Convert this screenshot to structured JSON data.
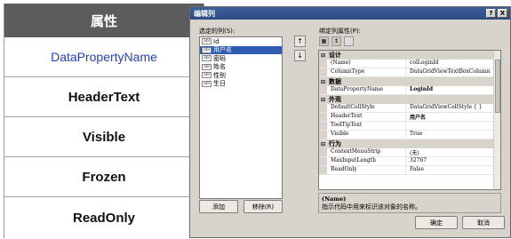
{
  "attr_table": {
    "header": "属性",
    "rows": [
      "DataPropertyName",
      "HeaderText",
      "Visible",
      "Frozen",
      "ReadOnly"
    ]
  },
  "dialog": {
    "title": "编辑列",
    "help_btn": "?",
    "close_btn": "X",
    "selected_columns_label": "选定的列(S):",
    "columns": [
      {
        "icon": "abl",
        "name": "Id"
      },
      {
        "icon": "abl",
        "name": "用户名"
      },
      {
        "icon": "abl",
        "name": "密码"
      },
      {
        "icon": "abl",
        "name": "姓名"
      },
      {
        "icon": "abl",
        "name": "性别"
      },
      {
        "icon": "abl",
        "name": "生日"
      }
    ],
    "selected_index": 1,
    "move_up": "↑",
    "move_down": "↓",
    "add_button": "添加",
    "remove_button": "移除(R)",
    "bound_props_label": "绑定列属性(P):",
    "property_grid": [
      {
        "type": "category",
        "toggle": "⊟",
        "name": "设计"
      },
      {
        "type": "prop",
        "name": "(Name)",
        "value": "colLoginId"
      },
      {
        "type": "prop",
        "name": "ColumnType",
        "value": "DataGridViewTextBoxColumn"
      },
      {
        "type": "category",
        "toggle": "⊟",
        "name": "数据"
      },
      {
        "type": "prop",
        "name": "DataPropertyName",
        "value": "LoginId",
        "bold": true
      },
      {
        "type": "category",
        "toggle": "⊟",
        "name": "外观"
      },
      {
        "type": "prop",
        "name": "DefaultCellStyle",
        "value": "DataGridViewCellStyle { }"
      },
      {
        "type": "prop",
        "name": "HeaderText",
        "value": "用户名",
        "bold": true
      },
      {
        "type": "prop",
        "name": "ToolTipText",
        "value": ""
      },
      {
        "type": "prop",
        "name": "Visible",
        "value": "True"
      },
      {
        "type": "category",
        "toggle": "⊟",
        "name": "行为"
      },
      {
        "type": "prop",
        "name": "ContextMenuStrip",
        "value": "(无)"
      },
      {
        "type": "prop",
        "name": "MaxInputLength",
        "value": "32767"
      },
      {
        "type": "prop",
        "name": "ReadOnly",
        "value": "False"
      }
    ],
    "description_title": "(Name)",
    "description_text": "指示代码中用来标识该对象的名称。",
    "ok_button": "确定",
    "cancel_button": "取消"
  }
}
